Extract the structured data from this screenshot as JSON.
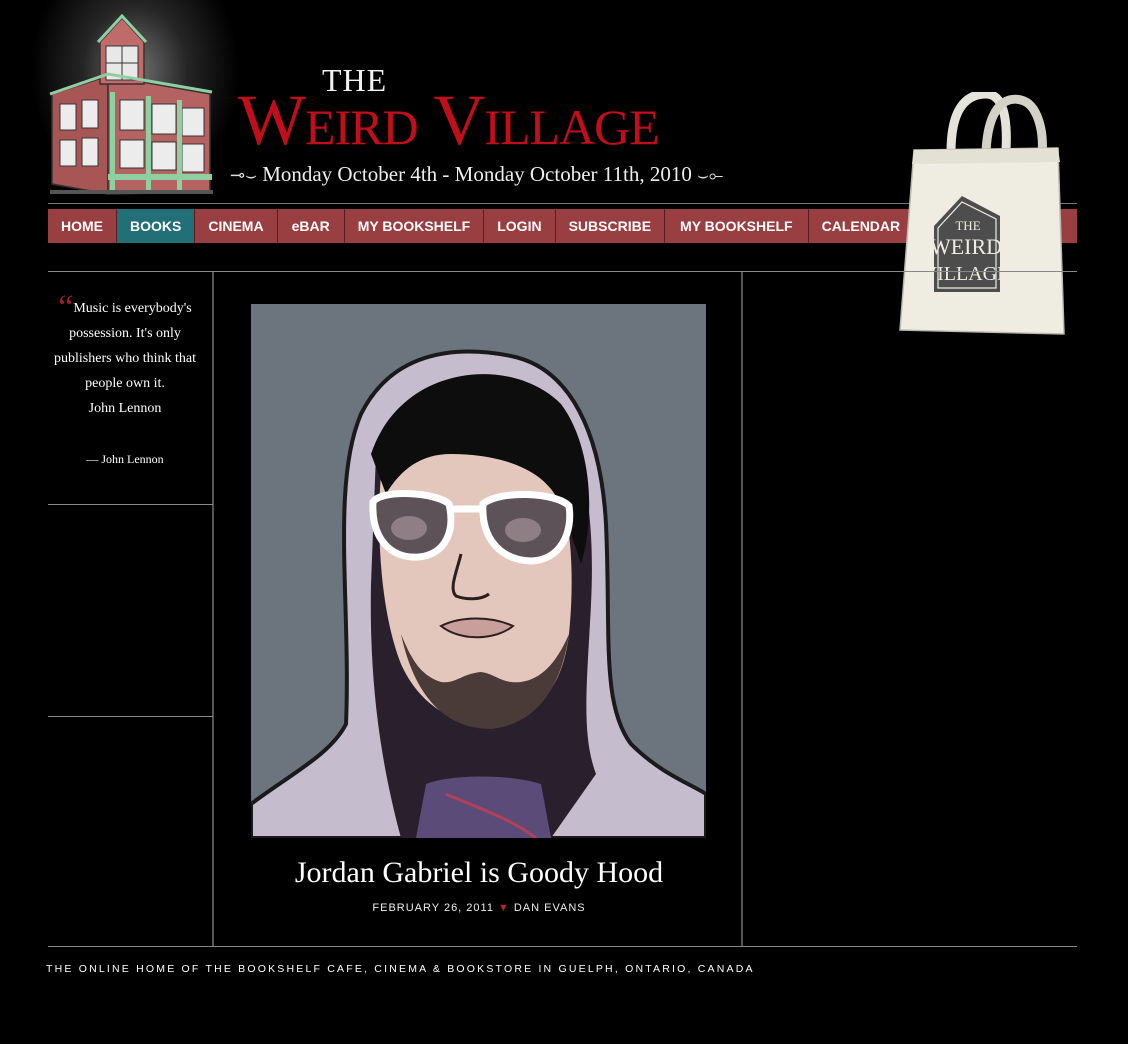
{
  "header": {
    "title_the": "THE",
    "title_main": "Weird Village",
    "date_range": "Monday October 4th - Monday October 11th, 2010"
  },
  "nav": {
    "items": [
      {
        "label": "HOME",
        "active": false
      },
      {
        "label": "BOOKS",
        "active": true
      },
      {
        "label": "CINEMA",
        "active": false
      },
      {
        "label": "eBAR",
        "active": false
      },
      {
        "label": "MY BOOKSHELF",
        "active": false
      },
      {
        "label": "LOGIN",
        "active": false
      },
      {
        "label": "SUBSCRIBE",
        "active": false
      },
      {
        "label": "MY BOOKSHELF",
        "active": false
      },
      {
        "label": "CALENDAR",
        "active": false
      }
    ]
  },
  "tote": {
    "logo_text": "The Weird Village"
  },
  "sidebar": {
    "quote_text": "Music is everybody's possession. It's only publishers who think that people own it.",
    "quote_author_inline": "John Lennon",
    "quote_cite": "— John Lennon"
  },
  "post": {
    "title": "Jordan Gabriel is Goody Hood",
    "date": "FEBRUARY 26, 2011",
    "author": "DAN EVANS"
  },
  "footer": {
    "text": "THE ONLINE HOME OF THE BOOKSHELF CAFE, CINEMA & BOOKSTORE IN GUELPH, ONTARIO, CANADA"
  },
  "colors": {
    "brand_red": "#c10e1a",
    "nav_bg": "#9a3f41",
    "nav_active": "#226f77"
  }
}
